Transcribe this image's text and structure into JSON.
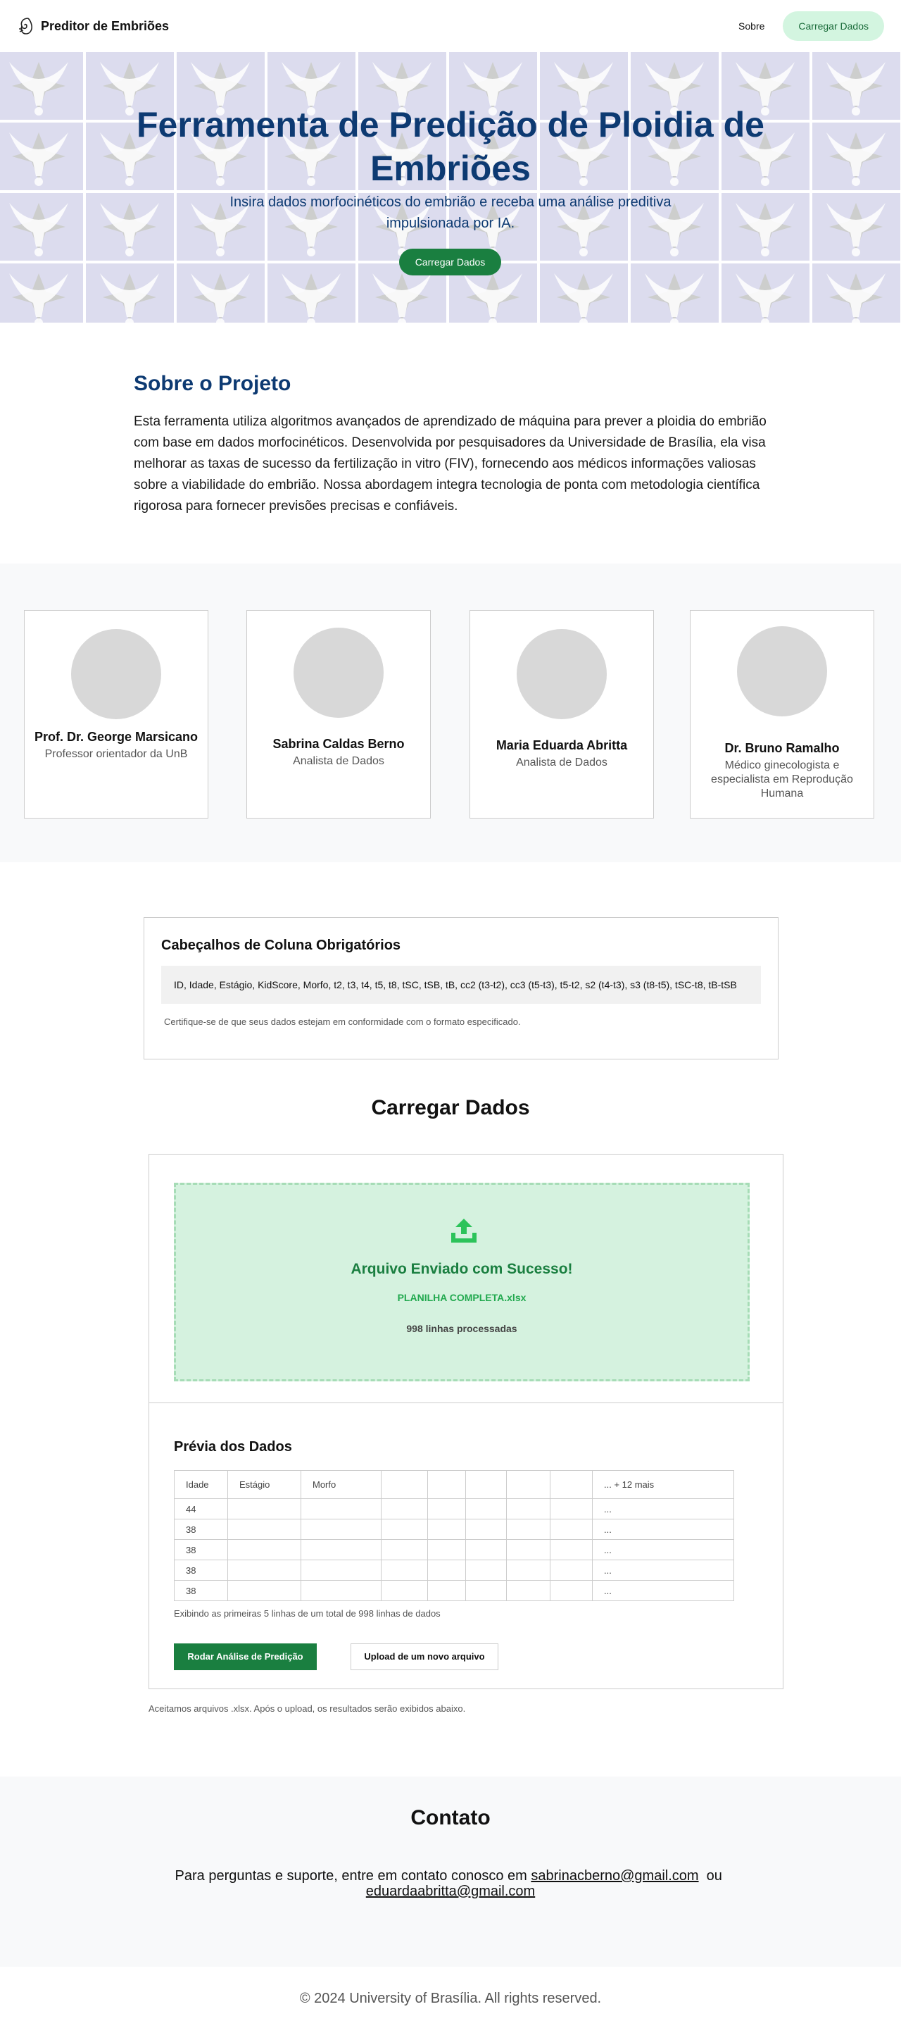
{
  "header": {
    "brand": "Preditor de Embriões",
    "nav": {
      "about": "Sobre",
      "upload": "Carregar Dados"
    }
  },
  "hero": {
    "title": "Ferramenta de Predição de Ploidia de Embriões",
    "subtitle": "Insira dados morfocinéticos do embrião e receba uma análise preditiva impulsionada por IA.",
    "button": "Carregar Dados"
  },
  "about": {
    "heading": "Sobre o Projeto",
    "text": "Esta ferramenta utiliza algoritmos avançados de aprendizado de máquina para prever a ploidia do embrião com base em dados morfocinéticos. Desenvolvida por pesquisadores da Universidade de Brasília, ela visa melhorar as taxas de sucesso da fertilização in vitro (FIV), fornecendo aos médicos informações valiosas sobre a viabilidade do embrião. Nossa abordagem integra tecnologia de ponta com metodologia científica rigorosa para fornecer previsões precisas e confiáveis."
  },
  "team": [
    {
      "name": "Prof. Dr. George Marsicano",
      "role": "Professor orientador da UnB"
    },
    {
      "name": "Sabrina Caldas Berno",
      "role": "Analista de Dados"
    },
    {
      "name": "Maria Eduarda Abritta",
      "role": "Analista de Dados"
    },
    {
      "name": "Dr. Bruno Ramalho",
      "role": "Médico ginecologista e especialista em Reprodução Humana"
    }
  ],
  "required_headers": {
    "heading": "Cabeçalhos de Coluna Obrigatórios",
    "columns": "ID, Idade, Estágio, KidScore, Morfo, t2, t3, t4, t5, t8, tSC, tSB, tB, cc2 (t3-t2), cc3 (t5-t3), t5-t2, s2 (t4-t3), s3 (t8-t5), tSC-t8, tB-tSB",
    "note": "Certifique-se de que seus dados estejam em conformidade com o formato especificado."
  },
  "upload": {
    "heading": "Carregar Dados",
    "success_title": "Arquivo Enviado com Sucesso!",
    "file_name": "PLANILHA COMPLETA.xlsx",
    "rows_processed": "998 linhas processadas",
    "preview_heading": "Prévia dos Dados",
    "table_headers": [
      "Idade",
      "Estágio",
      "Morfo",
      "",
      "",
      "",
      "",
      "",
      "... + 12 mais"
    ],
    "table_rows": [
      [
        "44",
        "",
        "",
        "",
        "",
        "",
        "",
        "",
        "..."
      ],
      [
        "38",
        "",
        "",
        "",
        "",
        "",
        "",
        "",
        "..."
      ],
      [
        "38",
        "",
        "",
        "",
        "",
        "",
        "",
        "",
        "..."
      ],
      [
        "38",
        "",
        "",
        "",
        "",
        "",
        "",
        "",
        "..."
      ],
      [
        "38",
        "",
        "",
        "",
        "",
        "",
        "",
        "",
        "..."
      ]
    ],
    "preview_note": "Exibindo as primeiras 5 linhas de um total de 998 linhas de dados",
    "run_button": "Rodar Análise de Predição",
    "new_upload_button": "Upload de um novo arquivo",
    "accept_note": "Aceitamos arquivos .xlsx. Após o upload, os resultados serão exibidos abaixo."
  },
  "contact": {
    "heading": "Contato",
    "text_before": "Para perguntas e suporte, entre em contato conosco em ",
    "email1": "sabrinacberno@gmail.com",
    "text_between": "  ou ",
    "email2": "eduardaabritta@gmail.com"
  },
  "footer": {
    "text": "© 2024 University of Brasília. All rights reserved."
  },
  "colors": {
    "primary_blue": "#0d3a72",
    "brand_green": "#1a7f40",
    "success_bg": "#d5f2df",
    "nav_button_bg": "#d3f5e0"
  },
  "icons": {
    "brand": "embryo-icon",
    "upload": "upload-icon"
  }
}
